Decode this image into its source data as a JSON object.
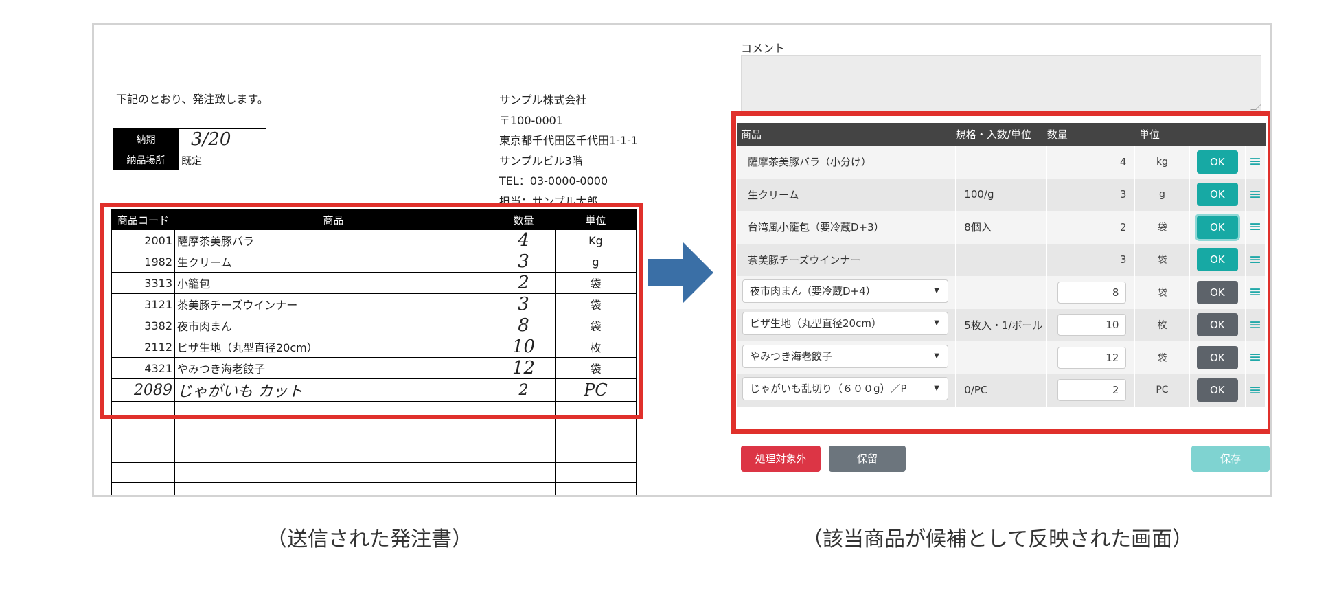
{
  "order_sheet": {
    "intro": "下記のとおり、発注致します。",
    "company_lines": [
      "サンプル株式会社",
      "〒100-0001",
      "東京都千代田区千代田1-1-1",
      "サンプルビル3階",
      "TEL：03-0000-0000",
      "担当：サンプル太郎"
    ],
    "delivery_date_label": "納期",
    "delivery_date_value": "3/20",
    "delivery_place_label": "納品場所",
    "delivery_place_value": "既定",
    "columns": [
      "商品コード",
      "商品",
      "数量",
      "単位"
    ],
    "rows": [
      {
        "code": "2001",
        "name": "薩摩茶美豚バラ",
        "qty": "4",
        "unit": "Kg"
      },
      {
        "code": "1982",
        "name": "生クリーム",
        "qty": "3",
        "unit": "g"
      },
      {
        "code": "3313",
        "name": "小籠包",
        "qty": "2",
        "unit": "袋"
      },
      {
        "code": "3121",
        "name": "茶美豚チーズウインナー",
        "qty": "3",
        "unit": "袋"
      },
      {
        "code": "3382",
        "name": "夜市肉まん",
        "qty": "8",
        "unit": "袋"
      },
      {
        "code": "2112",
        "name": "ピザ生地（丸型直径20cm）",
        "qty": "10",
        "unit": "枚"
      },
      {
        "code": "4321",
        "name": "やみつき海老餃子",
        "qty": "12",
        "unit": "袋"
      },
      {
        "code": "2089",
        "name": "じゃがいも カット",
        "qty": "2",
        "unit": "PC"
      }
    ]
  },
  "ui": {
    "comment_label": "コメント",
    "columns": {
      "product": "商品",
      "spec": "規格・入数/単位",
      "qty": "数量",
      "unit": "単位"
    },
    "rows": [
      {
        "product": "薩摩茶美豚バラ（小分け）",
        "spec": "",
        "qty": "4",
        "unit": "kg",
        "ok": "OK",
        "editable": false,
        "ok_state": "confirmed"
      },
      {
        "product": "生クリーム",
        "spec": "100/g",
        "qty": "3",
        "unit": "g",
        "ok": "OK",
        "editable": false,
        "ok_state": "confirmed"
      },
      {
        "product": "台湾風小籠包（要冷蔵D+3）",
        "spec": "8個入",
        "qty": "2",
        "unit": "袋",
        "ok": "OK",
        "editable": false,
        "ok_state": "focused"
      },
      {
        "product": "茶美豚チーズウインナー",
        "spec": "",
        "qty": "3",
        "unit": "袋",
        "ok": "OK",
        "editable": false,
        "ok_state": "confirmed"
      },
      {
        "product": "夜市肉まん（要冷蔵D+4）",
        "spec": "",
        "qty": "8",
        "unit": "袋",
        "ok": "OK",
        "editable": true,
        "ok_state": "pending"
      },
      {
        "product": "ピザ生地（丸型直径20cm）",
        "spec": "5枚入・1/ボール",
        "qty": "10",
        "unit": "枚",
        "ok": "OK",
        "editable": true,
        "ok_state": "pending"
      },
      {
        "product": "やみつき海老餃子",
        "spec": "",
        "qty": "12",
        "unit": "袋",
        "ok": "OK",
        "editable": true,
        "ok_state": "pending"
      },
      {
        "product": "じゃがいも乱切り（６００g）／P",
        "spec": "0/PC",
        "qty": "2",
        "unit": "PC",
        "ok": "OK",
        "editable": true,
        "ok_state": "pending"
      }
    ],
    "buttons": {
      "exclude": "処理対象外",
      "hold": "保留",
      "save": "保存"
    },
    "colors": {
      "highlight": "#e0302b",
      "ok_confirmed": "#17a9a4",
      "ok_pending": "#5d636a",
      "exclude": "#dc3545",
      "save": "#7fd3d1",
      "arrow": "#3a6fa6"
    }
  },
  "captions": {
    "left": "（送信された発注書）",
    "right": "（該当商品が候補として反映された画面）"
  }
}
